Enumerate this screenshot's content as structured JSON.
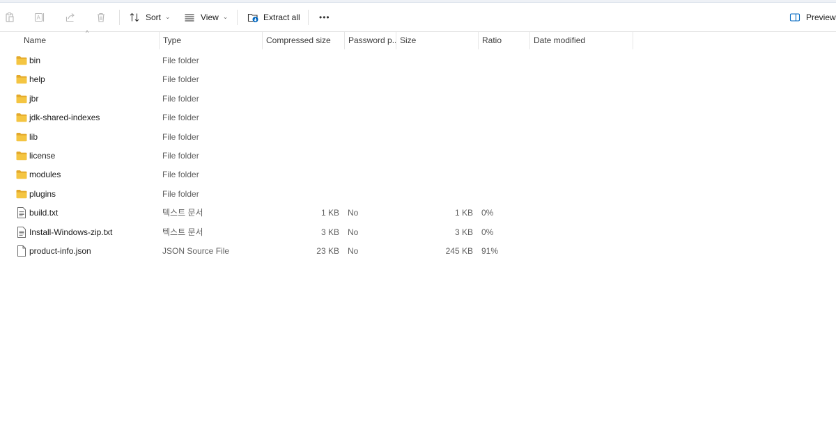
{
  "toolbar": {
    "sort_label": "Sort",
    "view_label": "View",
    "extract_label": "Extract all",
    "more_label": "•••",
    "preview_label": "Preview"
  },
  "columns": {
    "name": "Name",
    "type": "Type",
    "compressed": "Compressed size",
    "password": "Password p...",
    "size": "Size",
    "ratio": "Ratio",
    "date": "Date modified"
  },
  "files": [
    {
      "name": "bin",
      "kind": "folder",
      "type": "File folder",
      "compressed": "",
      "password": "",
      "size": "",
      "ratio": ""
    },
    {
      "name": "help",
      "kind": "folder",
      "type": "File folder",
      "compressed": "",
      "password": "",
      "size": "",
      "ratio": ""
    },
    {
      "name": "jbr",
      "kind": "folder",
      "type": "File folder",
      "compressed": "",
      "password": "",
      "size": "",
      "ratio": ""
    },
    {
      "name": "jdk-shared-indexes",
      "kind": "folder",
      "type": "File folder",
      "compressed": "",
      "password": "",
      "size": "",
      "ratio": ""
    },
    {
      "name": "lib",
      "kind": "folder",
      "type": "File folder",
      "compressed": "",
      "password": "",
      "size": "",
      "ratio": ""
    },
    {
      "name": "license",
      "kind": "folder",
      "type": "File folder",
      "compressed": "",
      "password": "",
      "size": "",
      "ratio": ""
    },
    {
      "name": "modules",
      "kind": "folder",
      "type": "File folder",
      "compressed": "",
      "password": "",
      "size": "",
      "ratio": ""
    },
    {
      "name": "plugins",
      "kind": "folder",
      "type": "File folder",
      "compressed": "",
      "password": "",
      "size": "",
      "ratio": ""
    },
    {
      "name": "build.txt",
      "kind": "text",
      "type": "텍스트 문서",
      "compressed": "1 KB",
      "password": "No",
      "size": "1 KB",
      "ratio": "0%"
    },
    {
      "name": "Install-Windows-zip.txt",
      "kind": "text",
      "type": "텍스트 문서",
      "compressed": "3 KB",
      "password": "No",
      "size": "3 KB",
      "ratio": "0%"
    },
    {
      "name": "product-info.json",
      "kind": "file",
      "type": "JSON Source File",
      "compressed": "23 KB",
      "password": "No",
      "size": "245 KB",
      "ratio": "91%"
    }
  ],
  "colors": {
    "folder": "#f4c542",
    "folder_dark": "#e3a92b",
    "accent": "#0067c0"
  }
}
